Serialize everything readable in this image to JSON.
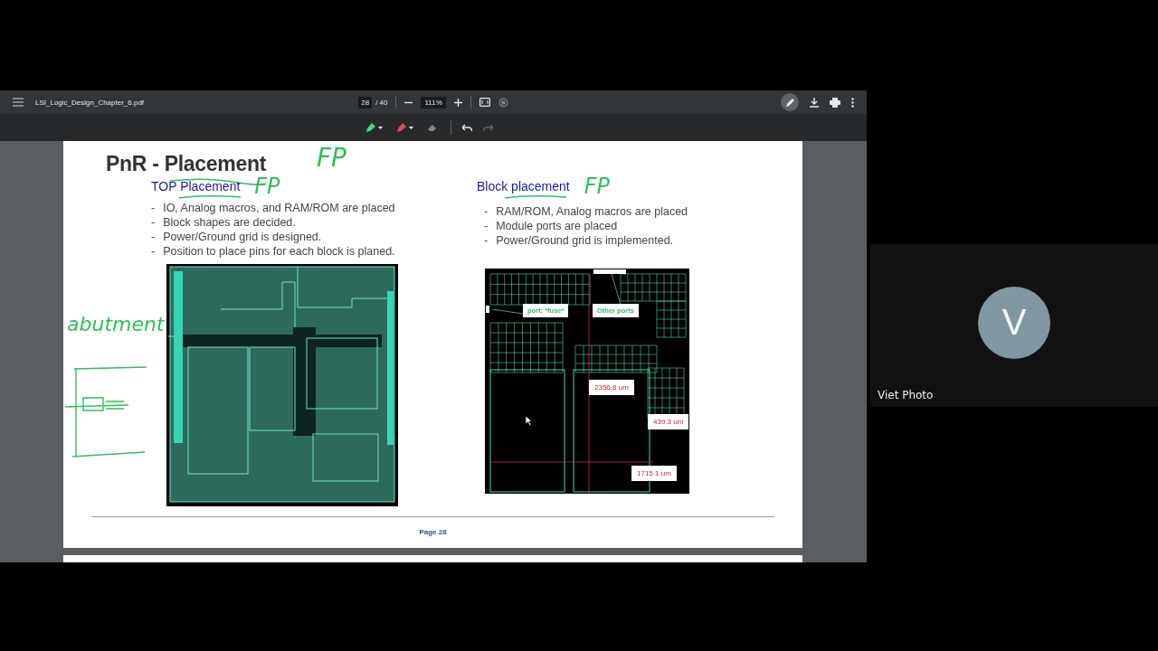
{
  "viewer": {
    "file_name": "LSI_Logic_Design_Chapter_6.pdf",
    "page_current": "28",
    "page_separator": "/",
    "page_total": "40",
    "zoom": "111%"
  },
  "annotation_tools": [
    {
      "kind": "pen",
      "color": "#3ddc84"
    },
    {
      "kind": "highlighter",
      "color": "#e8475f"
    },
    {
      "kind": "eraser"
    }
  ],
  "slide": {
    "title": "PnR - Placement",
    "handwritten_note": "FP",
    "sections": [
      {
        "heading": "TOP Placement",
        "handwritten_note": "FP",
        "bullet_marker": "-",
        "bullets": [
          "IO, Analog macros, and RAM/ROM are placed",
          "Block shapes are decided.",
          "Power/Ground grid is designed.",
          "Position to place pins for each block is planed."
        ],
        "figure": {
          "kind": "top",
          "handwritten_note": "abutment"
        }
      },
      {
        "heading": "Block placement",
        "handwritten_note": "FP",
        "bullet_marker": "-",
        "bullets": [
          "RAM/ROM, Analog macros are placed",
          "Module ports are placed",
          "Power/Ground grid is implemented."
        ],
        "figure": {
          "kind": "block",
          "labels": [
            {
              "kind": "callout",
              "text": "port: *fuse*"
            },
            {
              "kind": "callout",
              "text": "Other ports"
            },
            {
              "kind": "dimension",
              "text": "2356.8 um"
            },
            {
              "kind": "dimension",
              "text": "439.3 um"
            },
            {
              "kind": "dimension",
              "text": "1715.1 um"
            }
          ]
        }
      }
    ],
    "footer": "Page 28"
  },
  "participant": {
    "initial": "V",
    "name": "Viet Photo"
  }
}
